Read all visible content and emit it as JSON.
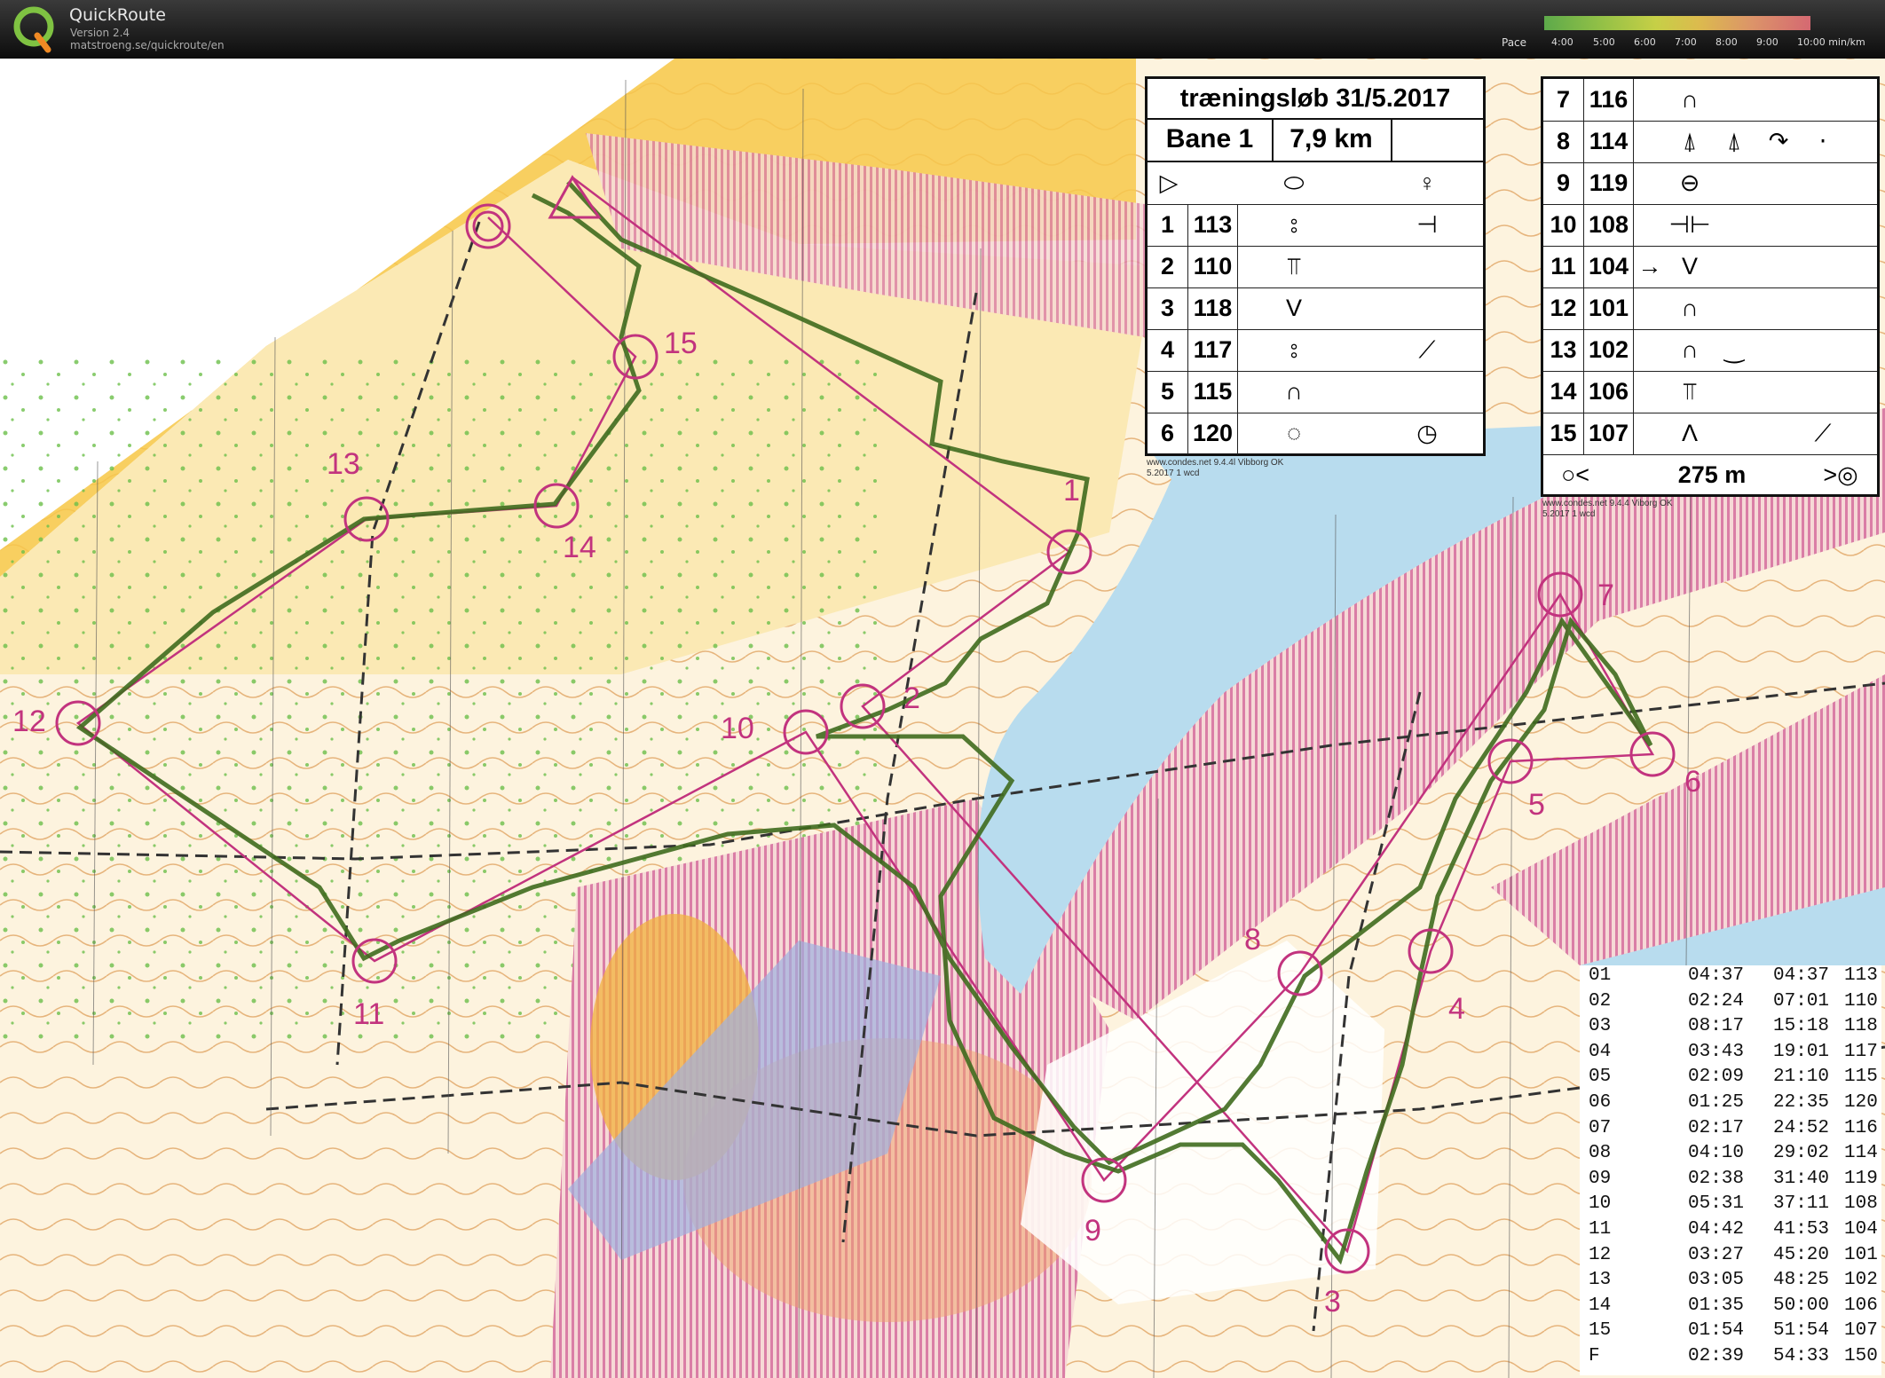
{
  "app": {
    "title": "QuickRoute",
    "version": "Version 2.4",
    "url": "matstroeng.se/quickroute/en",
    "logo_letter": "Q"
  },
  "pace_legend": {
    "label": "Pace",
    "ticks": [
      "4:00",
      "5:00",
      "6:00",
      "7:00",
      "8:00",
      "9:00",
      "10:00 min/km"
    ]
  },
  "course": {
    "event_title": "træningsløb 31/5.2017",
    "name": "Bane 1",
    "length": "7,9 km",
    "finish_distance": "275 m"
  },
  "controls_left": [
    {
      "num": "1",
      "code": "113"
    },
    {
      "num": "2",
      "code": "110"
    },
    {
      "num": "3",
      "code": "118"
    },
    {
      "num": "4",
      "code": "117"
    },
    {
      "num": "5",
      "code": "115"
    },
    {
      "num": "6",
      "code": "120"
    }
  ],
  "controls_right": [
    {
      "num": "7",
      "code": "116"
    },
    {
      "num": "8",
      "code": "114"
    },
    {
      "num": "9",
      "code": "119"
    },
    {
      "num": "10",
      "code": "108"
    },
    {
      "num": "11",
      "code": "104"
    },
    {
      "num": "12",
      "code": "101"
    },
    {
      "num": "13",
      "code": "102"
    },
    {
      "num": "14",
      "code": "106"
    },
    {
      "num": "15",
      "code": "107"
    }
  ],
  "map_credits": {
    "left": "www.condes.net 9.4.4l Vibborg OK",
    "left2": "5.2017 1 wcd",
    "right": "www.condes.net 9.4.4 Viborg OK",
    "right2": "5.2017 1 wcd"
  },
  "map_control_labels": [
    "1",
    "2",
    "3",
    "4",
    "5",
    "6",
    "7",
    "8",
    "9",
    "10",
    "11",
    "12",
    "13",
    "14",
    "15"
  ],
  "splits": [
    {
      "leg": "01",
      "split": "04:37",
      "total": "04:37",
      "code": "113"
    },
    {
      "leg": "02",
      "split": "02:24",
      "total": "07:01",
      "code": "110"
    },
    {
      "leg": "03",
      "split": "08:17",
      "total": "15:18",
      "code": "118"
    },
    {
      "leg": "04",
      "split": "03:43",
      "total": "19:01",
      "code": "117"
    },
    {
      "leg": "05",
      "split": "02:09",
      "total": "21:10",
      "code": "115"
    },
    {
      "leg": "06",
      "split": "01:25",
      "total": "22:35",
      "code": "120"
    },
    {
      "leg": "07",
      "split": "02:17",
      "total": "24:52",
      "code": "116"
    },
    {
      "leg": "08",
      "split": "04:10",
      "total": "29:02",
      "code": "114"
    },
    {
      "leg": "09",
      "split": "02:38",
      "total": "31:40",
      "code": "119"
    },
    {
      "leg": "10",
      "split": "05:31",
      "total": "37:11",
      "code": "108"
    },
    {
      "leg": "11",
      "split": "04:42",
      "total": "41:53",
      "code": "104"
    },
    {
      "leg": "12",
      "split": "03:27",
      "total": "45:20",
      "code": "101"
    },
    {
      "leg": "13",
      "split": "03:05",
      "total": "48:25",
      "code": "102"
    },
    {
      "leg": "14",
      "split": "01:35",
      "total": "50:00",
      "code": "106"
    },
    {
      "leg": "15",
      "split": "01:54",
      "total": "51:54",
      "code": "107"
    },
    {
      "leg": "F",
      "split": "02:39",
      "total": "54:33",
      "code": "150"
    }
  ],
  "colors": {
    "course": "#c2337e",
    "route": "#3f6b1e",
    "water": "#b8dcee",
    "open": "#f7c84a",
    "rough": "#fbe9b4",
    "forest": "#fdf6e8",
    "cliff": "#d63a6a",
    "contour": "#d78a3a"
  }
}
